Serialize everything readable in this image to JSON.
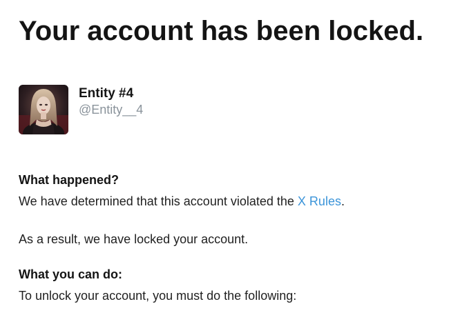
{
  "page": {
    "title": "Your account has been locked."
  },
  "profile": {
    "avatar_icon": "user-avatar-image",
    "display_name": "Entity #4",
    "handle": "@Entity__4"
  },
  "what_happened": {
    "heading": "What happened?",
    "sentence_prefix": "We have determined that this account violated the ",
    "rules_link": "X Rules",
    "sentence_suffix": ".",
    "result": "As a result, we have locked your account."
  },
  "what_you_can_do": {
    "heading": "What you can do:",
    "instruction": "To unlock your account, you must do the following:"
  },
  "colors": {
    "link": "#3b94d9",
    "handle": "#8a939b",
    "text": "#141414"
  }
}
